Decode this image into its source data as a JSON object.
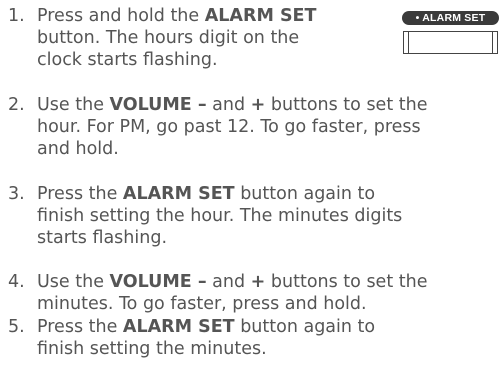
{
  "alarm_button_graphic": {
    "label": "• ALARM SET"
  },
  "steps": [
    {
      "number": "1.",
      "lines": [
        [
          "Press and hold the ",
          "ALARM SET",
          ""
        ],
        [
          "button. The hours digit on the"
        ],
        [
          "clock starts flashing."
        ]
      ]
    },
    {
      "number": "2.",
      "lines": [
        [
          "Use the ",
          "VOLUME –",
          " and ",
          "+",
          " buttons to set the"
        ],
        [
          "hour. For PM, go past 12. To go faster, press"
        ],
        [
          "and hold."
        ]
      ]
    },
    {
      "number": "3.",
      "lines": [
        [
          "Press the ",
          "ALARM SET",
          " button again to"
        ],
        [
          "finish setting the hour. The minutes digits"
        ],
        [
          "starts flashing."
        ]
      ]
    },
    {
      "number": "4.",
      "lines": [
        [
          "Use the ",
          "VOLUME –",
          " and ",
          "+",
          " buttons to set the"
        ],
        [
          "minutes. To go faster, press and hold."
        ]
      ]
    },
    {
      "number": "5.",
      "lines": [
        [
          "Press the ",
          "ALARM SET",
          " button again to"
        ],
        [
          "finish setting the minutes."
        ]
      ]
    }
  ]
}
